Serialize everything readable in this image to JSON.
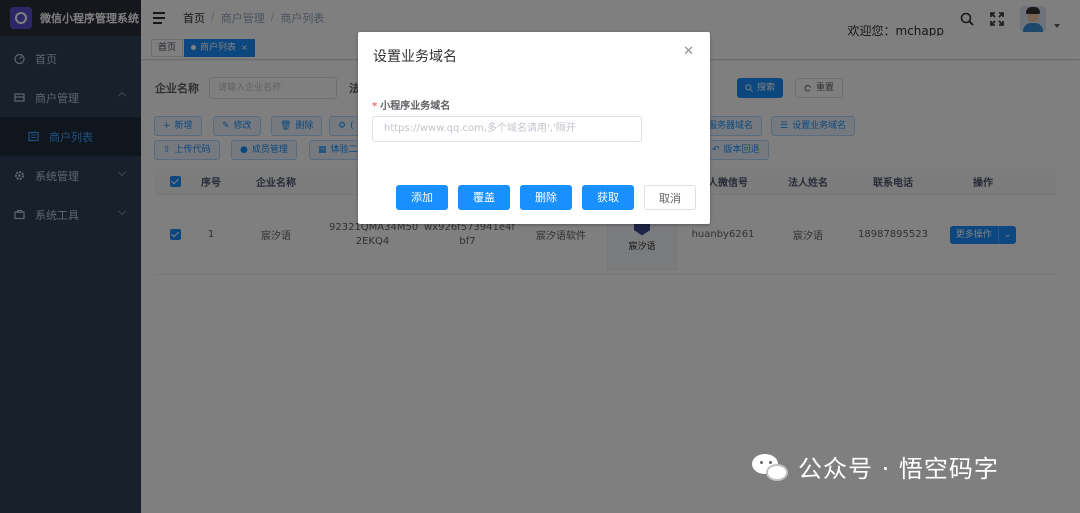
{
  "app": {
    "title": "微信小程序管理系统"
  },
  "sidebar": {
    "items": [
      {
        "label": "首页"
      },
      {
        "label": "商户管理"
      },
      {
        "label": "商户列表"
      },
      {
        "label": "系统管理"
      },
      {
        "label": "系统工具"
      }
    ]
  },
  "navbar": {
    "breadcrumb": [
      "首页",
      "商户管理",
      "商户列表"
    ],
    "welcome": "欢迎您：mchapp"
  },
  "tags": {
    "home": "首页",
    "active": "商户列表"
  },
  "search": {
    "company_label": "企业名称",
    "company_placeholder": "请输入企业名称",
    "legal_label": "法",
    "search_btn": "搜索",
    "reset_btn": "重置"
  },
  "toolbar": {
    "add": "新增",
    "edit": "修改",
    "delete": "删除",
    "partial": "(",
    "server_domain": "服务器域名",
    "biz_domain": "设置业务域名",
    "upload": "上传代码",
    "members": "成员管理",
    "qrcode": "体验二维",
    "rollback": "版本回退"
  },
  "table": {
    "headers": [
      "序号",
      "企业名称",
      "",
      "",
      "",
      "",
      "法人微信号",
      "法人姓名",
      "联系电话",
      "操作"
    ],
    "rows": [
      {
        "index": "1",
        "company": "宸汐语",
        "credit_code": "92321QMA34M50 2EKQ4",
        "appid": "wx926f573941e4f bf7",
        "app_name": "宸汐语软件",
        "logo_text": "宸汐语",
        "wechat": "huanby6261",
        "legal_name": "宸汐语",
        "phone": "18987895523",
        "action": "更多操作"
      }
    ]
  },
  "modal": {
    "title": "设置业务域名",
    "required_mark": "*",
    "field_label": "小程序业务域名",
    "placeholder": "https://www.qq.com,多个域名请用','隔开",
    "btn_add": "添加",
    "btn_cover": "覆盖",
    "btn_delete": "删除",
    "btn_fetch": "获取",
    "btn_cancel": "取消"
  },
  "watermark": {
    "text": "公众号 · 悟空码字"
  },
  "colors": {
    "primary": "#1890ff",
    "sidebar": "#304156",
    "sidebar_active": "#409eff"
  }
}
